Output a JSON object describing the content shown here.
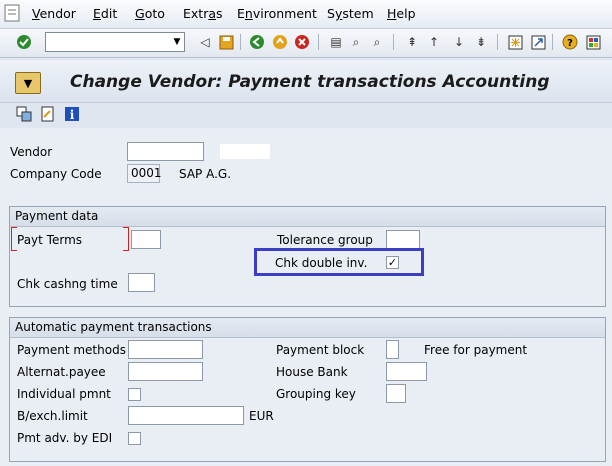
{
  "menu": {
    "items": [
      "Vendor",
      "Edit",
      "Goto",
      "Extras",
      "Environment",
      "System",
      "Help"
    ],
    "underline": [
      "V",
      "E",
      "G",
      "a",
      "n",
      "y",
      "H"
    ]
  },
  "title": {
    "text": "Change Vendor: Payment transactions Accounting"
  },
  "header": {
    "vendor_label": "Vendor",
    "company_code_label": "Company Code",
    "company_code_value": "0001",
    "company_name": "SAP A.G."
  },
  "payment_data": {
    "title": "Payment data",
    "payt_terms_label": "Payt Terms",
    "tolerance_group_label": "Tolerance group",
    "chk_double_inv_label": "Chk double inv.",
    "chk_double_inv_checked": "✓",
    "chk_cashng_time_label": "Chk cashng time"
  },
  "auto_payment": {
    "title": "Automatic payment transactions",
    "payment_methods_label": "Payment methods",
    "payment_block_label": "Payment block",
    "payment_block_text": "Free for payment",
    "alternat_payee_label": "Alternat.payee",
    "house_bank_label": "House Bank",
    "individual_pmnt_label": "Individual pmnt",
    "grouping_key_label": "Grouping key",
    "bexch_limit_label": "B/exch.limit",
    "bexch_currency": "EUR",
    "pmt_adv_edi_label": "Pmt adv. by EDI"
  },
  "colors": {
    "highlight": "#3a3ec4",
    "required_marker": "#d1221f"
  }
}
